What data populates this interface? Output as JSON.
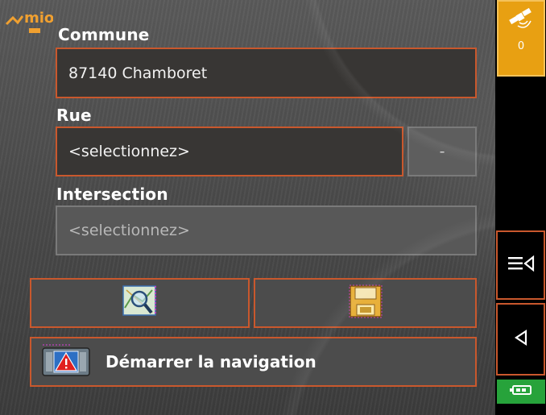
{
  "brand": {
    "logo_text": "mio"
  },
  "form": {
    "commune": {
      "label": "Commune",
      "value": "87140 Chamboret"
    },
    "rue": {
      "label": "Rue",
      "value": "<selectionnez>",
      "number_value": "-"
    },
    "intersection": {
      "label": "Intersection",
      "value": "<selectionnez>"
    }
  },
  "actions": {
    "navigate_label": "Démarrer la navigation"
  },
  "status": {
    "gps_satellite_count": "0",
    "gps_color": "#e8a012",
    "battery_color": "#27a33b"
  },
  "icons": {
    "gps": "satellite-icon",
    "map_search": "map-search-icon",
    "save": "floppy-disk-icon",
    "navigate": "navigation-warning-icon",
    "menu": "menu-list-icon",
    "back": "back-arrow-icon",
    "battery": "battery-icon"
  },
  "colors": {
    "accent_border": "#c9582d"
  }
}
